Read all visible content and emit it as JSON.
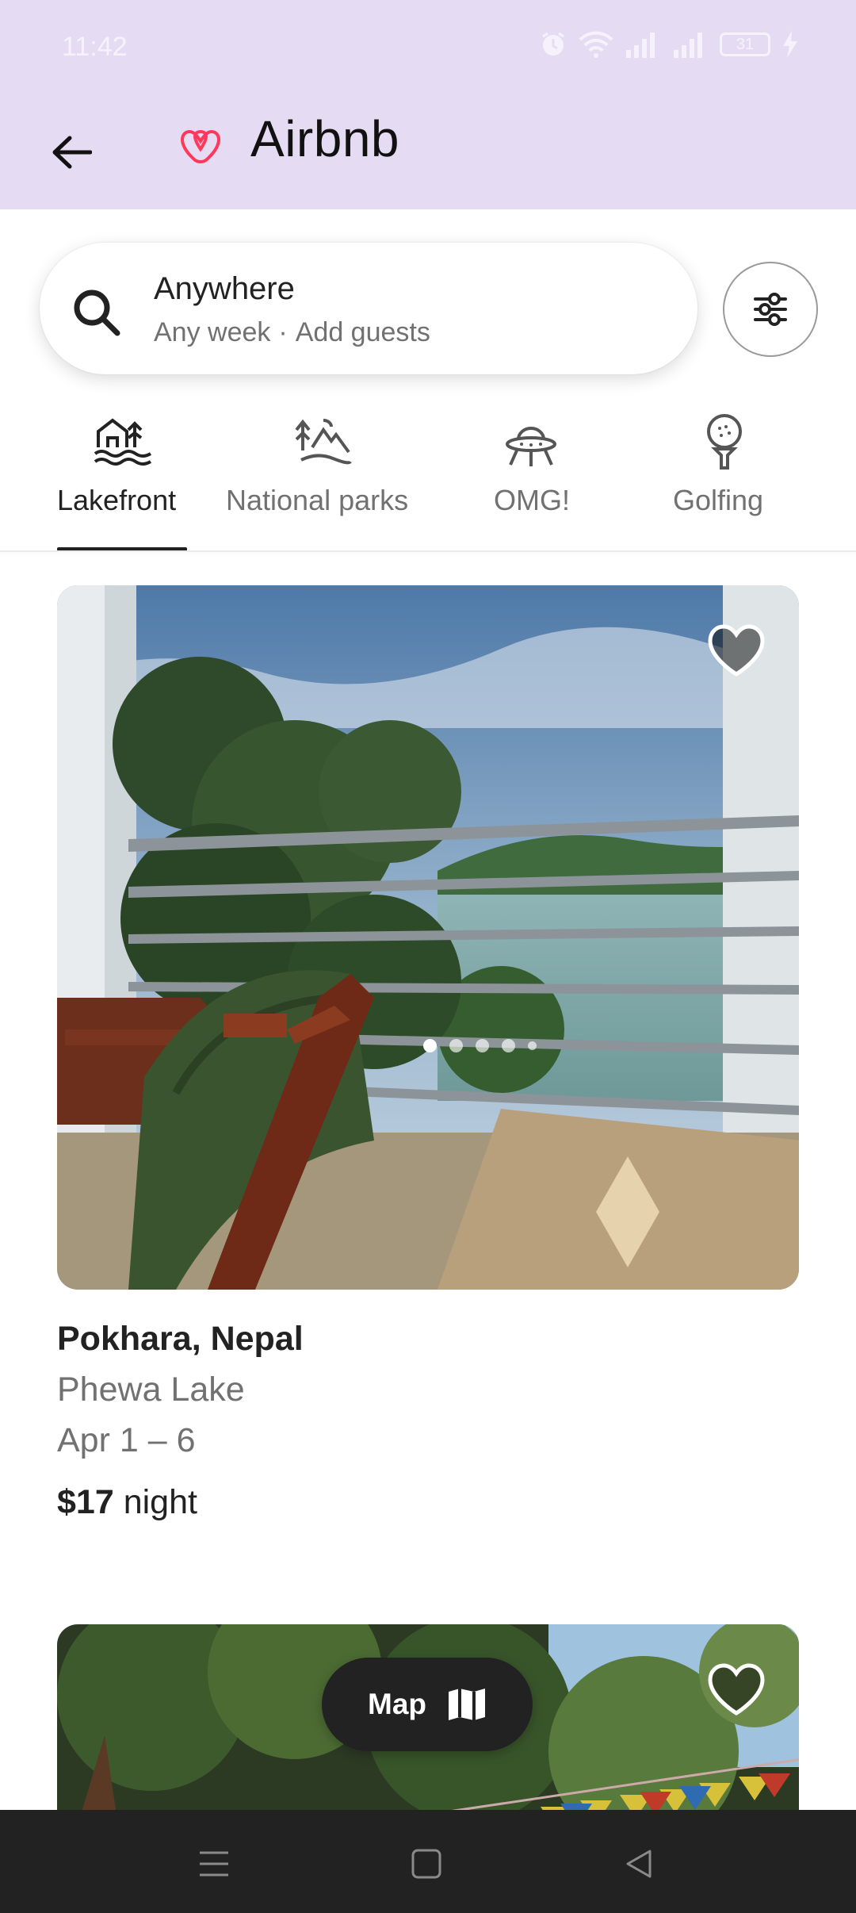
{
  "status_bar": {
    "time": "11:42",
    "battery": "31"
  },
  "app_bar": {
    "title": "Airbnb"
  },
  "search": {
    "title": "Anywhere",
    "when": "Any week",
    "separator": "·",
    "guests": "Add guests"
  },
  "categories": [
    {
      "label": "Lakefront",
      "icon": "lakefront-icon",
      "active": true
    },
    {
      "label": "National parks",
      "icon": "national-parks-icon",
      "active": false
    },
    {
      "label": "OMG!",
      "icon": "ufo-icon",
      "active": false
    },
    {
      "label": "Golfing",
      "icon": "golf-icon",
      "active": false
    }
  ],
  "listings": [
    {
      "location": "Pokhara, Nepal",
      "place": "Phewa Lake",
      "dates": "Apr 1 – 6",
      "price": "$17",
      "price_unit": "night",
      "photo_count": 5,
      "current_photo": 1
    }
  ],
  "map_button": {
    "label": "Map"
  },
  "colors": {
    "brand": "#FF385C",
    "header_bg": "#E5DCF3",
    "text": "#222222",
    "muted": "#717171"
  }
}
